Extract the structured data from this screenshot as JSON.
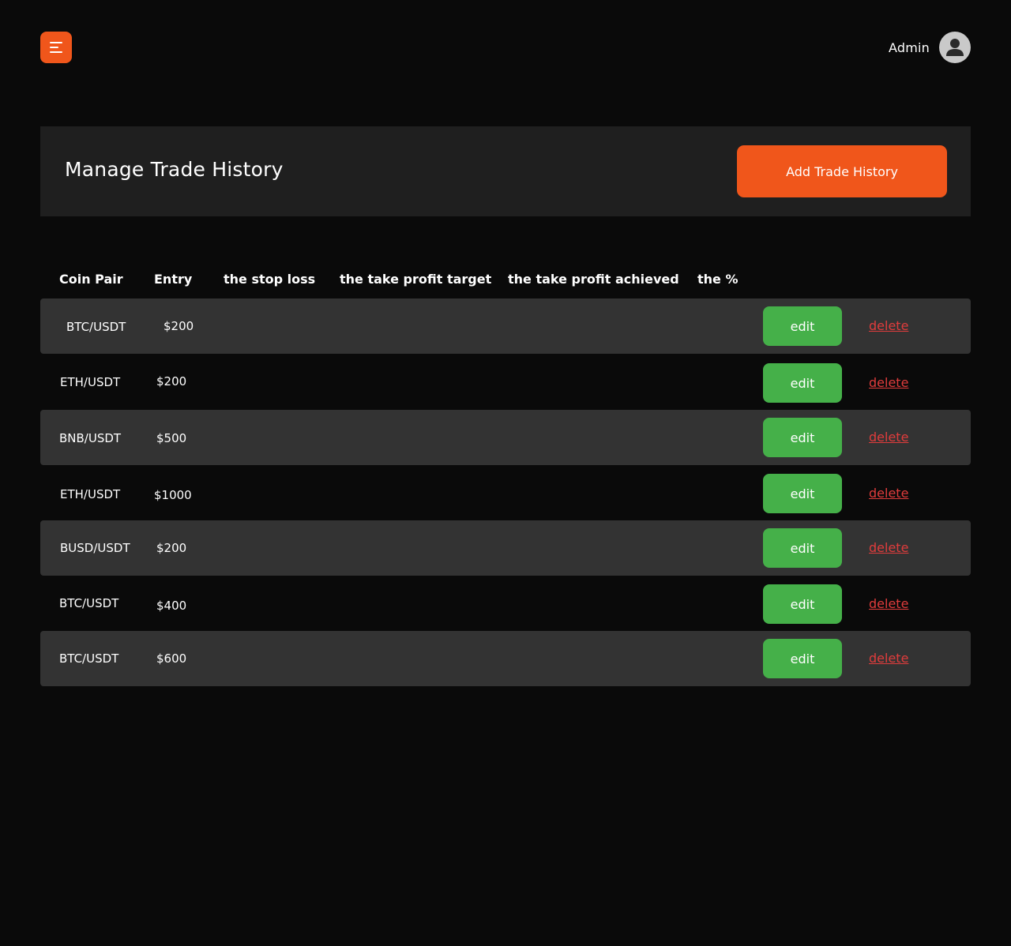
{
  "header": {
    "user_name": "Admin"
  },
  "panel": {
    "title": "Manage Trade History",
    "add_button": "Add Trade History"
  },
  "table": {
    "columns": [
      "Coin Pair",
      "Entry",
      "the stop loss",
      "the take profit target",
      "the take profit achieved",
      "the %"
    ],
    "rows": [
      {
        "pair": "BTC/USDT",
        "entry": "$200",
        "edit": "edit",
        "delete": "delete"
      },
      {
        "pair": "ETH/USDT",
        "entry": "$200",
        "edit": "edit",
        "delete": "delete"
      },
      {
        "pair": "BNB/USDT",
        "entry": "$500",
        "edit": "edit",
        "delete": "delete"
      },
      {
        "pair": "ETH/USDT",
        "entry": "$1000",
        "edit": "edit",
        "delete": "delete"
      },
      {
        "pair": "BUSD/USDT",
        "entry": "$200",
        "edit": "edit",
        "delete": "delete"
      },
      {
        "pair": "BTC/USDT",
        "entry": "$400",
        "edit": "edit",
        "delete": "delete"
      },
      {
        "pair": "BTC/USDT",
        "entry": "$600",
        "edit": "edit",
        "delete": "delete"
      }
    ]
  },
  "colors": {
    "accent": "#f0561b",
    "edit": "#45b049",
    "delete": "#e03c3c",
    "background": "#0a0a0a",
    "panel": "#1f1f1f",
    "row_shaded": "#333333"
  },
  "icons": [
    "menu-icon",
    "user-avatar-icon"
  ]
}
